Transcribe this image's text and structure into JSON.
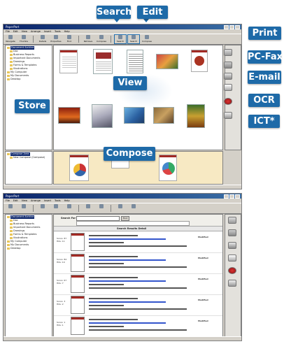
{
  "callouts": {
    "search": "Search",
    "edit": "Edit",
    "print": "Print",
    "pcfax": "PC-Fax",
    "email": "E-mail",
    "ocr": "OCR",
    "ict": "ICT*",
    "store": "Store",
    "view": "View",
    "compose": "Compose"
  },
  "top_window": {
    "menu": [
      "File",
      "Edit",
      "View",
      "Arrange",
      "Insert",
      "Tools",
      "Help"
    ],
    "toolbar": [
      "Navigate",
      "Thumbs",
      "Details",
      "Properties",
      "Find",
      "Retrieve",
      "Compose",
      "Search",
      "Search",
      "Compose"
    ],
    "tree": [
      "Document Archive",
      "Doc",
      "Business Reports",
      "Important Documents",
      "Drawings",
      "Forms & Templates",
      "Illustrations",
      "My Computer",
      "My Documents",
      "Desktop"
    ],
    "compose_tree": [
      "Compose Area",
      "New Compose (Compose)"
    ]
  },
  "bottom_window": {
    "menu": [
      "File",
      "Edit",
      "View",
      "Arrange",
      "Insert",
      "Tools",
      "Help"
    ],
    "tree": [
      "Document Archive",
      "Doc",
      "Business Reports",
      "Important Documents",
      "Drawings",
      "Forms & Templates",
      "Illustrations",
      "My Computer",
      "My Documents",
      "Desktop"
    ],
    "search_for_label": "Search For",
    "search_button": "Find",
    "results_title": "Search Results Detail",
    "results": [
      {
        "score": "Score: 87",
        "hits": "Hits: 11",
        "date": "Modified"
      },
      {
        "score": "Score: 84",
        "hits": "Hits: 10",
        "date": "Modified"
      },
      {
        "score": "Score: 67",
        "hits": "Hits: 7",
        "date": "Modified"
      },
      {
        "score": "Score: 3",
        "hits": "Hits: 2",
        "date": "Modified"
      },
      {
        "score": "Score: 1",
        "hits": "Hits: 1",
        "date": "Modified"
      }
    ]
  },
  "colors": {
    "callout": "#1e6aa8",
    "titlebar": "#0a246a",
    "window_bg": "#d4d0c8",
    "doc_accent": "#a12a24",
    "compose_bg": "#f7e9c3"
  },
  "apps": [
    "printer-icon",
    "fax-icon",
    "email-icon",
    "ocr-icon",
    "ict-icon"
  ]
}
